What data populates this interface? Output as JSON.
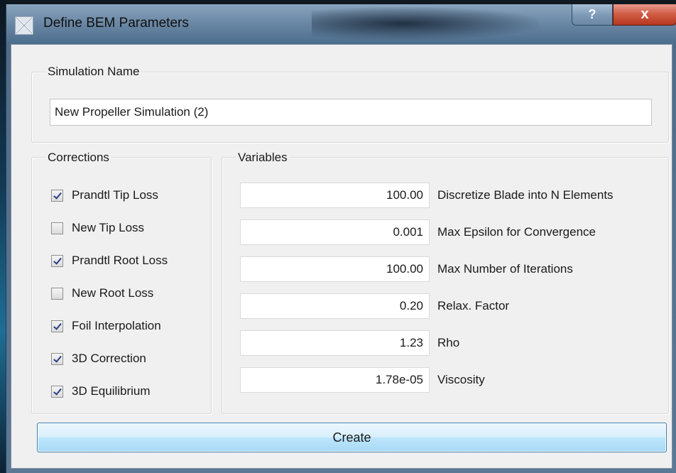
{
  "window": {
    "title": "Define BEM Parameters",
    "help_glyph": "?",
    "close_glyph": "x"
  },
  "simulation": {
    "group_title": "Simulation Name",
    "name_value": "New Propeller Simulation (2)"
  },
  "corrections": {
    "group_title": "Corrections",
    "items": [
      {
        "label": "Prandtl Tip Loss",
        "checked": true
      },
      {
        "label": "New Tip Loss",
        "checked": false
      },
      {
        "label": "Prandtl Root Loss",
        "checked": true
      },
      {
        "label": "New Root Loss",
        "checked": false
      },
      {
        "label": "Foil Interpolation",
        "checked": true
      },
      {
        "label": "3D Correction",
        "checked": true
      },
      {
        "label": "3D Equilibrium",
        "checked": true
      }
    ]
  },
  "variables": {
    "group_title": "Variables",
    "items": [
      {
        "value": "100.00",
        "label": "Discretize Blade into N Elements"
      },
      {
        "value": "0.001",
        "label": "Max Epsilon for Convergence"
      },
      {
        "value": "100.00",
        "label": "Max Number of Iterations"
      },
      {
        "value": "0.20",
        "label": "Relax. Factor"
      },
      {
        "value": "1.23",
        "label": "Rho"
      },
      {
        "value": "1.78e-05",
        "label": "Viscosity"
      }
    ]
  },
  "actions": {
    "create_label": "Create"
  },
  "colors": {
    "accent": "#3c7fb1",
    "checkmark": "#2b3f87",
    "close_button": "#cf5a44"
  }
}
